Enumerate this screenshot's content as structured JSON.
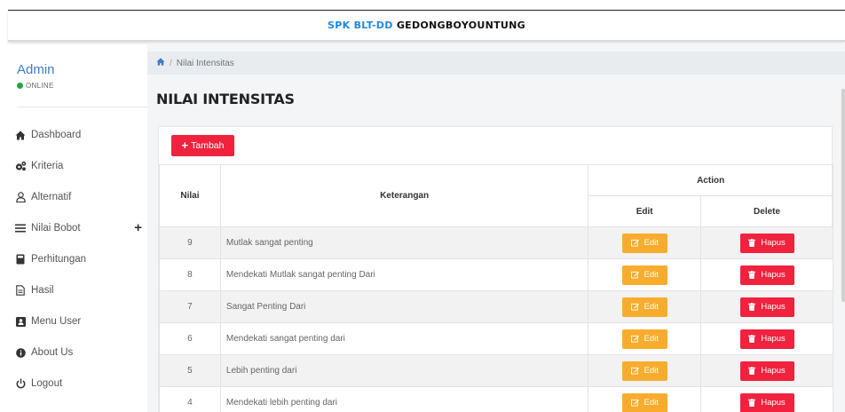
{
  "header": {
    "brand_part1": "SPK BLT-DD",
    "brand_part2": "GEDONGBOYOUNTUNG"
  },
  "sidebar": {
    "user_name": "Admin",
    "user_status": "ONLINE",
    "items": [
      {
        "label": "Dashboard",
        "icon": "home-icon"
      },
      {
        "label": "Kriteria",
        "icon": "cogs-icon"
      },
      {
        "label": "Alternatif",
        "icon": "user-icon"
      },
      {
        "label": "Nilai Bobot",
        "icon": "list-icon"
      },
      {
        "label": "Perhitungan",
        "icon": "calculator-icon"
      },
      {
        "label": "Hasil",
        "icon": "file-icon"
      },
      {
        "label": "Menu User",
        "icon": "user-card-icon"
      },
      {
        "label": "About Us",
        "icon": "info-icon"
      },
      {
        "label": "Logout",
        "icon": "power-icon"
      }
    ]
  },
  "breadcrumb": {
    "current": "Nilai Intensitas"
  },
  "page": {
    "title": "NILAI INTENSITAS",
    "add_label": "Tambah"
  },
  "table": {
    "headers": {
      "nilai": "Nilai",
      "keterangan": "Keterangan",
      "action": "Action",
      "edit": "Edit",
      "delete": "Delete"
    },
    "edit_label": "Edit",
    "delete_label": "Hapus",
    "rows": [
      {
        "nilai": "9",
        "keterangan": "Mutlak sangat penting"
      },
      {
        "nilai": "8",
        "keterangan": "Mendekati Mutlak sangat penting Dari"
      },
      {
        "nilai": "7",
        "keterangan": "Sangat Penting Dari"
      },
      {
        "nilai": "6",
        "keterangan": "Mendekati sangat penting dari"
      },
      {
        "nilai": "5",
        "keterangan": "Lebih penting dari"
      },
      {
        "nilai": "4",
        "keterangan": "Mendekati lebih penting dari"
      }
    ]
  },
  "colors": {
    "primary": "#1e88e5",
    "danger": "#f0223e",
    "warning": "#f8ac2e",
    "online": "#27a344"
  }
}
